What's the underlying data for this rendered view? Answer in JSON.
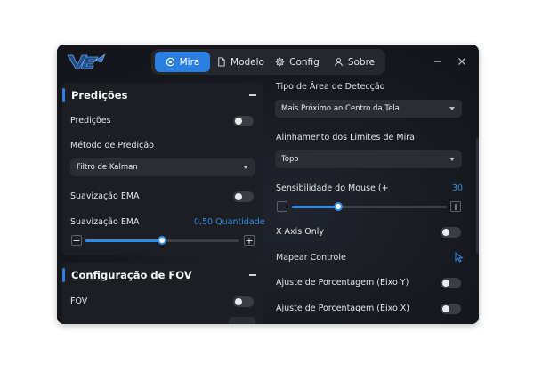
{
  "app": {
    "logo_text": "VENTRO"
  },
  "nav": {
    "tabs": [
      {
        "label": "Mira",
        "icon": "target-icon",
        "active": true
      },
      {
        "label": "Modelo",
        "icon": "file-icon",
        "active": false
      },
      {
        "label": "Config",
        "icon": "gear-icon",
        "active": false
      },
      {
        "label": "Sobre",
        "icon": "user-icon",
        "active": false
      }
    ]
  },
  "window_controls": {
    "minimize": "minimize-icon",
    "close": "close-icon"
  },
  "predicoes": {
    "title": "Predições",
    "toggle_label": "Predições",
    "toggle_on": false,
    "metodo_label": "Método de Predição",
    "metodo_value": "Filtro de Kalman",
    "ema_toggle_label": "Suavização EMA",
    "ema_toggle_on": false,
    "ema_slider_label": "Suavização EMA",
    "ema_slider_value_text": "0,50 Quantidade",
    "ema_slider_fraction": 0.5
  },
  "fov": {
    "title": "Configuração de FOV",
    "fov_label": "FOV",
    "fov_on": false
  },
  "right": {
    "area_label": "Tipo de Área de Detecção",
    "area_value": "Mais Próximo ao Centro da Tela",
    "align_label": "Alinhamento dos Limites de Mira",
    "align_value": "Topo",
    "sens_label": "Sensibilidade do Mouse (+",
    "sens_value": "30",
    "sens_fraction": 0.3,
    "xaxis_label": "X Axis Only",
    "xaxis_on": false,
    "mapear_label": "Mapear Controle",
    "ajuste_y_label": "Ajuste de Porcentagem (Eixo Y)",
    "ajuste_y_on": false,
    "ajuste_x_label": "Ajuste de Porcentagem (Eixo X)",
    "ajuste_x_on": false
  },
  "colors": {
    "accent": "#2b7fe0",
    "background": "#15171d",
    "panel": "#1c1e24",
    "value": "#2f8be6"
  }
}
